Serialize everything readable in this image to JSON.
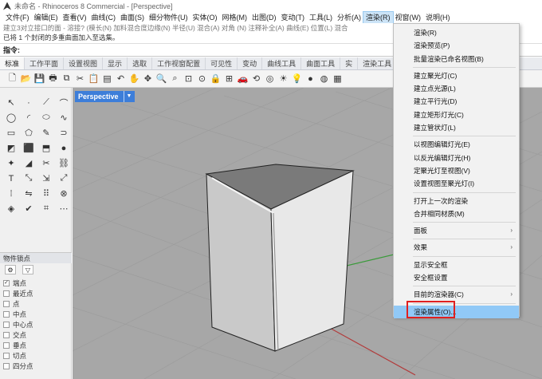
{
  "window": {
    "title": "未命名 - Rhinoceros 8 Commercial - [Perspective]"
  },
  "menubar": {
    "items": [
      "文件(F)",
      "编辑(E)",
      "查看(V)",
      "曲线(C)",
      "曲面(S)",
      "细分物件(U)",
      "实体(O)",
      "网格(M)",
      "出图(D)",
      "变动(T)",
      "工具(L)",
      "分析(A)",
      "渲染(R)",
      "视窗(W)",
      "说明(H)"
    ],
    "active": "渲染(R)"
  },
  "command": {
    "history_line1": "建立3对立接口的面 - 溶接? (模长(N) 加料混合度边缘(N) 半径(U) 混合(A) 对角 (N) 注释补全(A) 曲线(E) 位置(L) 混合",
    "history_line2": "已将 1 个封闭的多重曲面加入至选集。",
    "prompt": "指令:"
  },
  "tabs": {
    "items": [
      "标准",
      "工作平面",
      "设置视图",
      "显示",
      "选取",
      "工作视窗配置",
      "可见性",
      "变动",
      "曲线工具",
      "曲面工具",
      "实",
      "渲染工具"
    ],
    "selected": "标准"
  },
  "osnap": {
    "title": "物件锁点",
    "items": [
      {
        "label": "端点",
        "checked": true
      },
      {
        "label": "最近点",
        "checked": false
      },
      {
        "label": "点",
        "checked": false
      },
      {
        "label": "中点",
        "checked": false
      },
      {
        "label": "中心点",
        "checked": false
      },
      {
        "label": "交点",
        "checked": false
      },
      {
        "label": "垂点",
        "checked": false
      },
      {
        "label": "切点",
        "checked": false
      },
      {
        "label": "四分点",
        "checked": false
      }
    ]
  },
  "viewport": {
    "label": "Perspective"
  },
  "render_menu": {
    "items": [
      {
        "label": "渲染(R)"
      },
      {
        "label": "渲染预览(P)"
      },
      {
        "label": "批量渲染已命名视图(B)"
      },
      {
        "sep": true
      },
      {
        "label": "建立聚光灯(C)"
      },
      {
        "label": "建立点光源(L)"
      },
      {
        "label": "建立平行光(D)"
      },
      {
        "label": "建立矩形灯光(C)"
      },
      {
        "label": "建立管状灯(L)"
      },
      {
        "sep": true
      },
      {
        "label": "以视图编辑灯光(E)"
      },
      {
        "label": "以反光编辑灯光(H)"
      },
      {
        "label": "定聚光灯至视图(V)"
      },
      {
        "label": "设置视图至聚光灯(I)"
      },
      {
        "sep": true
      },
      {
        "label": "打开上一次的渲染"
      },
      {
        "label": "合并相同材质(M)"
      },
      {
        "sep": true
      },
      {
        "label": "面板",
        "sub": true
      },
      {
        "sep": true
      },
      {
        "label": "效果",
        "sub": true
      },
      {
        "sep": true
      },
      {
        "label": "显示安全框"
      },
      {
        "label": "安全框设置"
      },
      {
        "sep": true
      },
      {
        "label": "目前的渲染器(C)",
        "sub": true
      },
      {
        "sep": true
      },
      {
        "label": "渲染属性(O)...",
        "hl": true
      }
    ]
  }
}
